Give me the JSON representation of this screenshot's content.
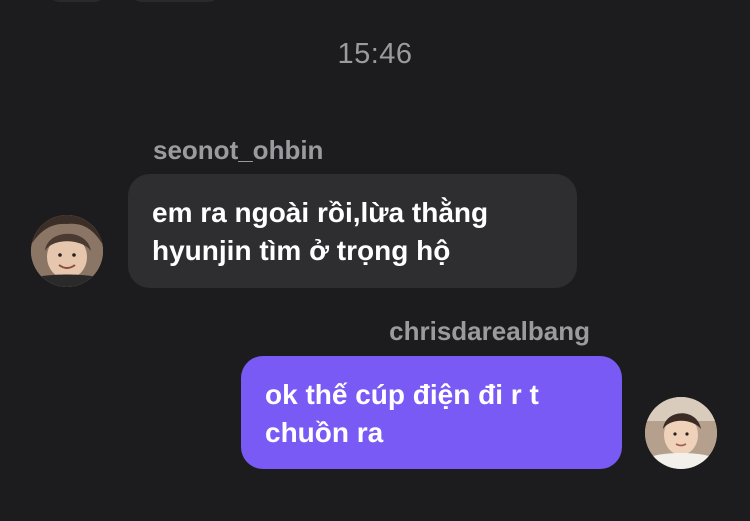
{
  "conversation": {
    "timestamp": "15:46",
    "messages": [
      {
        "sender": "seonot_ohbin",
        "text": "em ra ngoài rồi,lừa thằng\nhyunjin tìm ở trọng hộ",
        "direction": "incoming",
        "avatar_icon": "user-avatar-photo"
      },
      {
        "sender": "chrisdarealbang",
        "text": "ok thế cúp điện đi r t\nchuồn ra",
        "direction": "outgoing",
        "avatar_icon": "user-avatar-photo"
      }
    ]
  },
  "colors": {
    "background": "#1c1c1e",
    "incoming_bubble": "#2e2e31",
    "outgoing_bubble": "#7a5af5",
    "meta_text": "#9a9a9f",
    "message_text": "#ffffff"
  }
}
